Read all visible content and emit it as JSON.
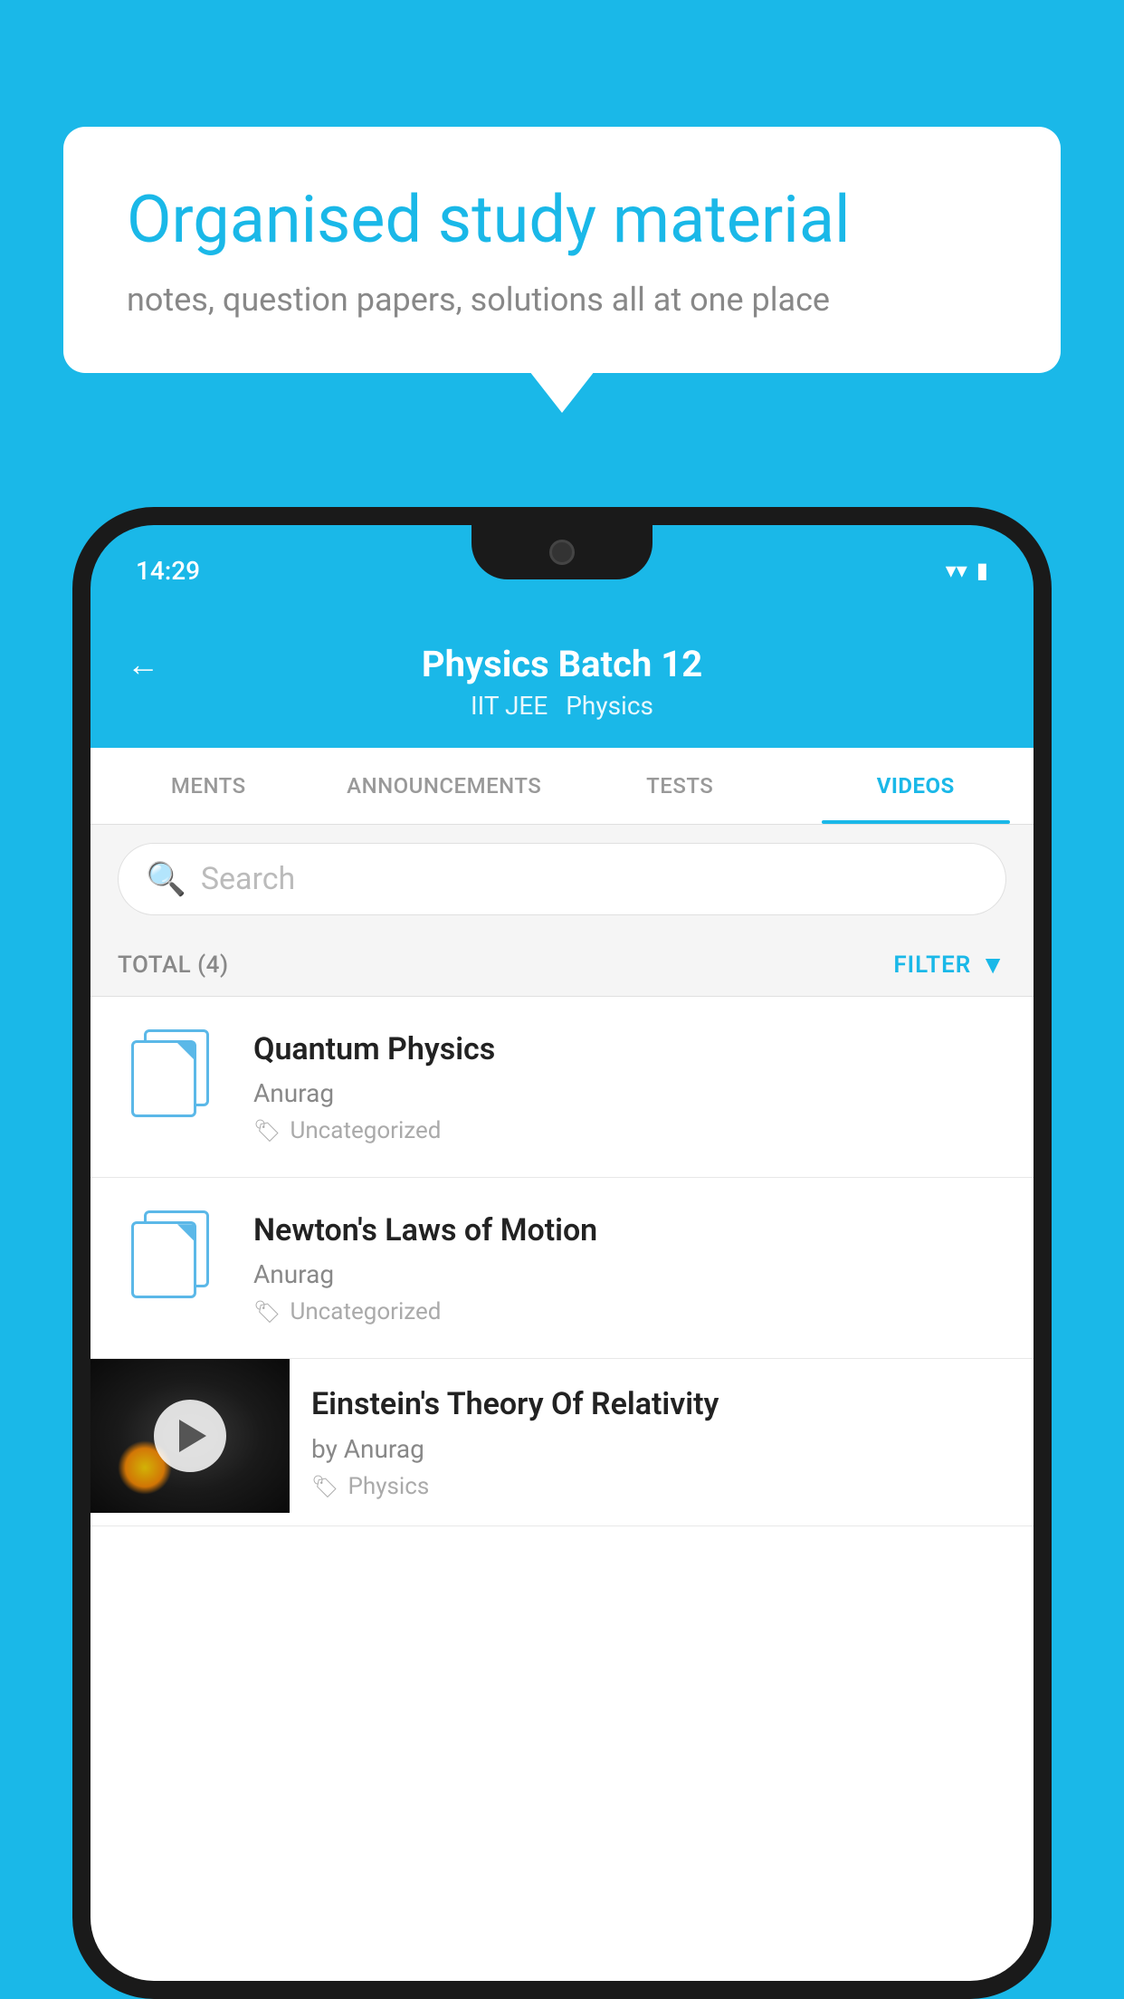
{
  "bubble": {
    "title": "Organised study material",
    "subtitle": "notes, question papers, solutions all at one place"
  },
  "status_bar": {
    "time": "14:29",
    "wifi_icon": "▼",
    "signal_icon": "▲",
    "battery_icon": "▮"
  },
  "app_header": {
    "back_label": "←",
    "title": "Physics Batch 12",
    "tag1": "IIT JEE",
    "tag2": "Physics"
  },
  "tabs": [
    {
      "label": "MENTS",
      "active": false
    },
    {
      "label": "ANNOUNCEMENTS",
      "active": false
    },
    {
      "label": "TESTS",
      "active": false
    },
    {
      "label": "VIDEOS",
      "active": true
    }
  ],
  "search": {
    "placeholder": "Search"
  },
  "filter_bar": {
    "total_label": "TOTAL (4)",
    "filter_label": "FILTER"
  },
  "videos": [
    {
      "title": "Quantum Physics",
      "author": "Anurag",
      "tag": "Uncategorized",
      "has_thumb": false
    },
    {
      "title": "Newton's Laws of Motion",
      "author": "Anurag",
      "tag": "Uncategorized",
      "has_thumb": false
    },
    {
      "title": "Einstein's Theory Of Relativity",
      "author": "by Anurag",
      "tag": "Physics",
      "has_thumb": true
    }
  ]
}
